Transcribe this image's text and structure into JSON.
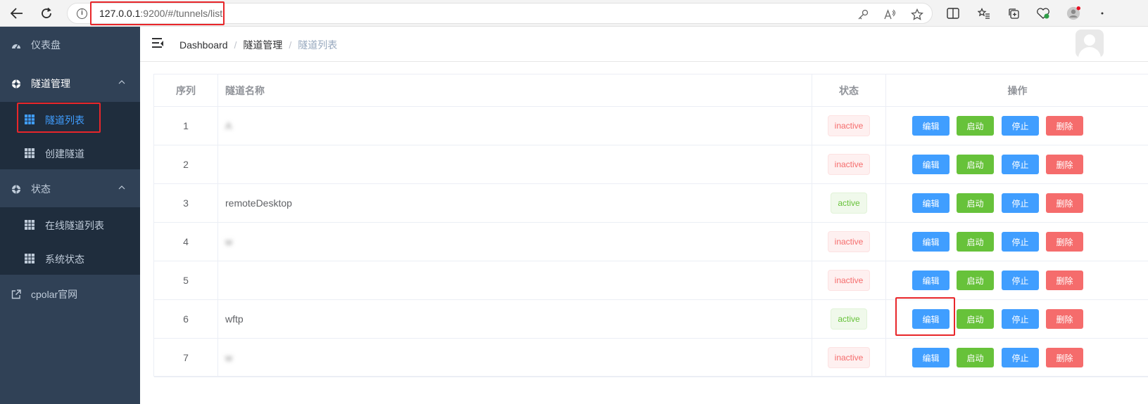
{
  "browser": {
    "url_host": "127.0.0.1",
    "url_path": ":9200/#/tunnels/list",
    "back_icon": "arrow-left-icon",
    "reload_icon": "reload-icon"
  },
  "sidebar": {
    "items": [
      {
        "label": "仪表盘",
        "icon": "dashboard-icon"
      },
      {
        "label": "隧道管理",
        "icon": "tunnel-icon",
        "children": [
          {
            "label": "隧道列表",
            "icon": "table-icon",
            "active": true
          },
          {
            "label": "创建隧道",
            "icon": "table-icon"
          }
        ]
      },
      {
        "label": "状态",
        "icon": "status-icon",
        "children": [
          {
            "label": "在线隧道列表",
            "icon": "table-icon"
          },
          {
            "label": "系统状态",
            "icon": "table-icon"
          }
        ]
      },
      {
        "label": "cpolar官网",
        "icon": "external-link-icon"
      }
    ]
  },
  "header": {
    "breadcrumb": [
      "Dashboard",
      "隧道管理",
      "隧道列表"
    ]
  },
  "table": {
    "columns": [
      "序列",
      "隧道名称",
      "状态",
      "操作"
    ],
    "actions": [
      "编辑",
      "启动",
      "停止",
      "删除"
    ],
    "rows": [
      {
        "index": "1",
        "name": "A",
        "status": "inactive",
        "blurred": true
      },
      {
        "index": "2",
        "name": "",
        "status": "inactive",
        "blurred": true
      },
      {
        "index": "3",
        "name": "remoteDesktop",
        "status": "active",
        "blurred": false
      },
      {
        "index": "4",
        "name": "w",
        "status": "inactive",
        "blurred": true
      },
      {
        "index": "5",
        "name": "",
        "status": "inactive",
        "blurred": true
      },
      {
        "index": "6",
        "name": "wftp",
        "status": "active",
        "blurred": false
      },
      {
        "index": "7",
        "name": "w",
        "status": "inactive",
        "blurred": true
      }
    ]
  },
  "colors": {
    "sidebar_bg": "#304156",
    "submenu_bg": "#1f2d3d",
    "primary": "#409eff",
    "success": "#67c23a",
    "danger": "#f56c6c",
    "annotation": "#e8262a"
  }
}
